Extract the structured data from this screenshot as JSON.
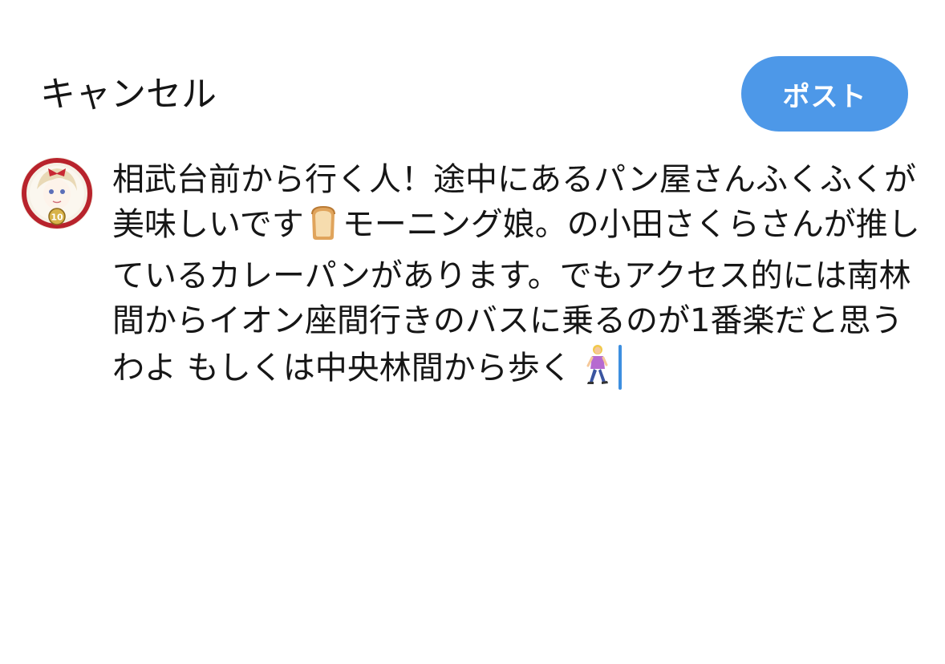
{
  "header": {
    "cancel_label": "キャンセル",
    "post_label": "ポスト"
  },
  "composer": {
    "segments": [
      {
        "type": "text",
        "value": "相武台前から行く人！途中にあるパン屋さんふくふくが美味しいです"
      },
      {
        "type": "emoji",
        "icon": "bread-icon"
      },
      {
        "type": "text",
        "value": "モーニング娘。の小田さくらさんが推しているカレーパンがあります。でもアクセス的には南林間からイオン座間行きのバスに乗るのが1番楽だと思うわよ もしくは中央林間から歩く "
      },
      {
        "type": "emoji",
        "icon": "woman-walking-icon"
      }
    ]
  },
  "avatar": {
    "badge_text": "10"
  },
  "colors": {
    "post_button": "#4d98e8",
    "caret": "#3d8fe0",
    "text": "#161616"
  }
}
